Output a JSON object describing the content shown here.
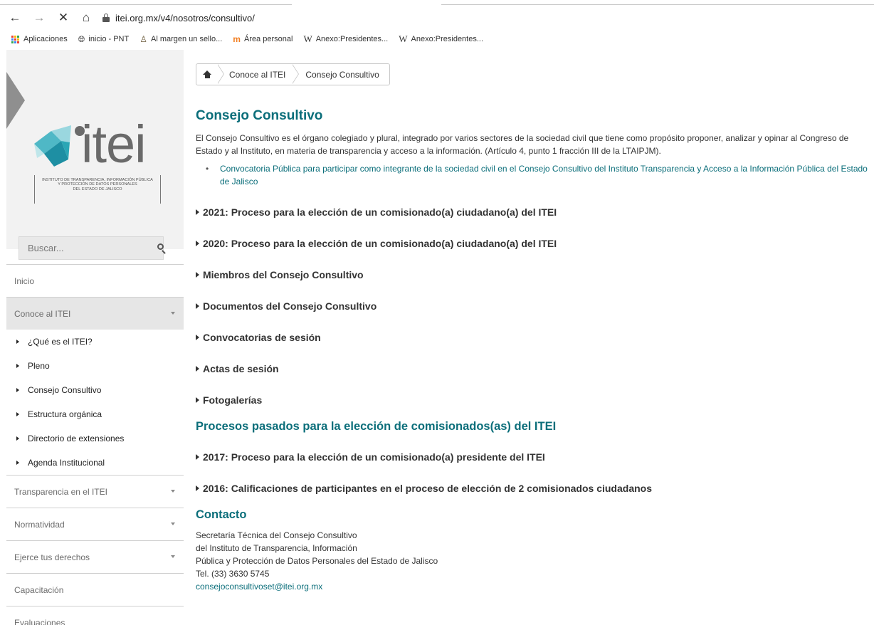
{
  "browser": {
    "url": "itei.org.mx/v4/nosotros/consultivo/",
    "bookmarks": [
      {
        "label": "Aplicaciones",
        "icon": "apps-grid-icon"
      },
      {
        "label": "inicio - PNT",
        "icon": "globe-icon"
      },
      {
        "label": "Al margen un sello...",
        "icon": "seal-icon"
      },
      {
        "label": "Área personal",
        "icon": "moodle-icon"
      },
      {
        "label": "Anexo:Presidentes...",
        "icon": "wikipedia-icon"
      },
      {
        "label": "Anexo:Presidentes...",
        "icon": "wikipedia-icon"
      }
    ]
  },
  "logo": {
    "word": "itei",
    "subtitle_lines": [
      "INSTITUTO DE TRANSPARENCIA, INFORMACIÓN PÚBLICA",
      "Y PROTECCIÓN DE DATOS PERSONALES",
      "DEL ESTADO DE JALISCO"
    ]
  },
  "search": {
    "placeholder": "Buscar..."
  },
  "menu": {
    "inicio": "Inicio",
    "conoce": "Conoce al ITEI",
    "submenu": [
      "¿Qué es el ITEI?",
      "Pleno",
      "Consejo Consultivo",
      "Estructura orgánica",
      "Directorio de extensiones",
      "Agenda Institucional"
    ],
    "transparencia": "Transparencia en el ITEI",
    "normatividad": "Normatividad",
    "ejerce": "Ejerce tus derechos",
    "capacitacion": "Capacitación",
    "evaluaciones": "Evaluaciones"
  },
  "breadcrumb": {
    "link": "Conoce al ITEI",
    "current": "Consejo Consultivo"
  },
  "content": {
    "title": "Consejo Consultivo",
    "intro_line1": "El Consejo Consultivo es el órgano colegiado y plural, integrado por varios sectores de la sociedad civil que tiene como propósito proponer, analizar y opinar al Congreso de",
    "intro_line2": "Estado y al Instituto, en materia de transparencia y acceso a la información. (Artículo 4, punto 1 fracción III de la LTAIPJM).",
    "convocatoria_line1": "Convocatoria Pública para participar como integrante de la sociedad civil en el Consejo Consultivo del Instituto Transparencia y Acceso a la Información Pública del Estado",
    "convocatoria_line2": "de Jalisco",
    "accordions": [
      "2021: Proceso para la elección de un comisionado(a) ciudadano(a) del ITEI",
      "2020: Proceso para la elección de un comisionado(a) ciudadano(a) del ITEI",
      "Miembros del Consejo Consultivo",
      "Documentos del Consejo Consultivo",
      "Convocatorias de sesión",
      "Actas de sesión",
      "Fotogalerías"
    ],
    "past_title": "Procesos pasados para la elección de comisionados(as) del ITEI",
    "past_accordions": [
      "2017: Proceso para la elección de un comisionado(a) presidente del ITEI",
      "2016: Calificaciones de participantes en el proceso de elección de 2 comisionados ciudadanos"
    ],
    "contact_title": "Contacto",
    "contact_lines": [
      "Secretaría Técnica del Consejo Consultivo",
      "del Instituto de Transparencia, Información",
      "Pública y Protección de Datos Personales del Estado de Jalisco",
      "Tel. (33) 3630 5745"
    ],
    "contact_email": "consejoconsultivoset@itei.org.mx"
  },
  "colors": {
    "accent": "#0b6e7a",
    "sidebar_bg": "#f2f2f2",
    "active_menu": "#e6e6e6"
  }
}
